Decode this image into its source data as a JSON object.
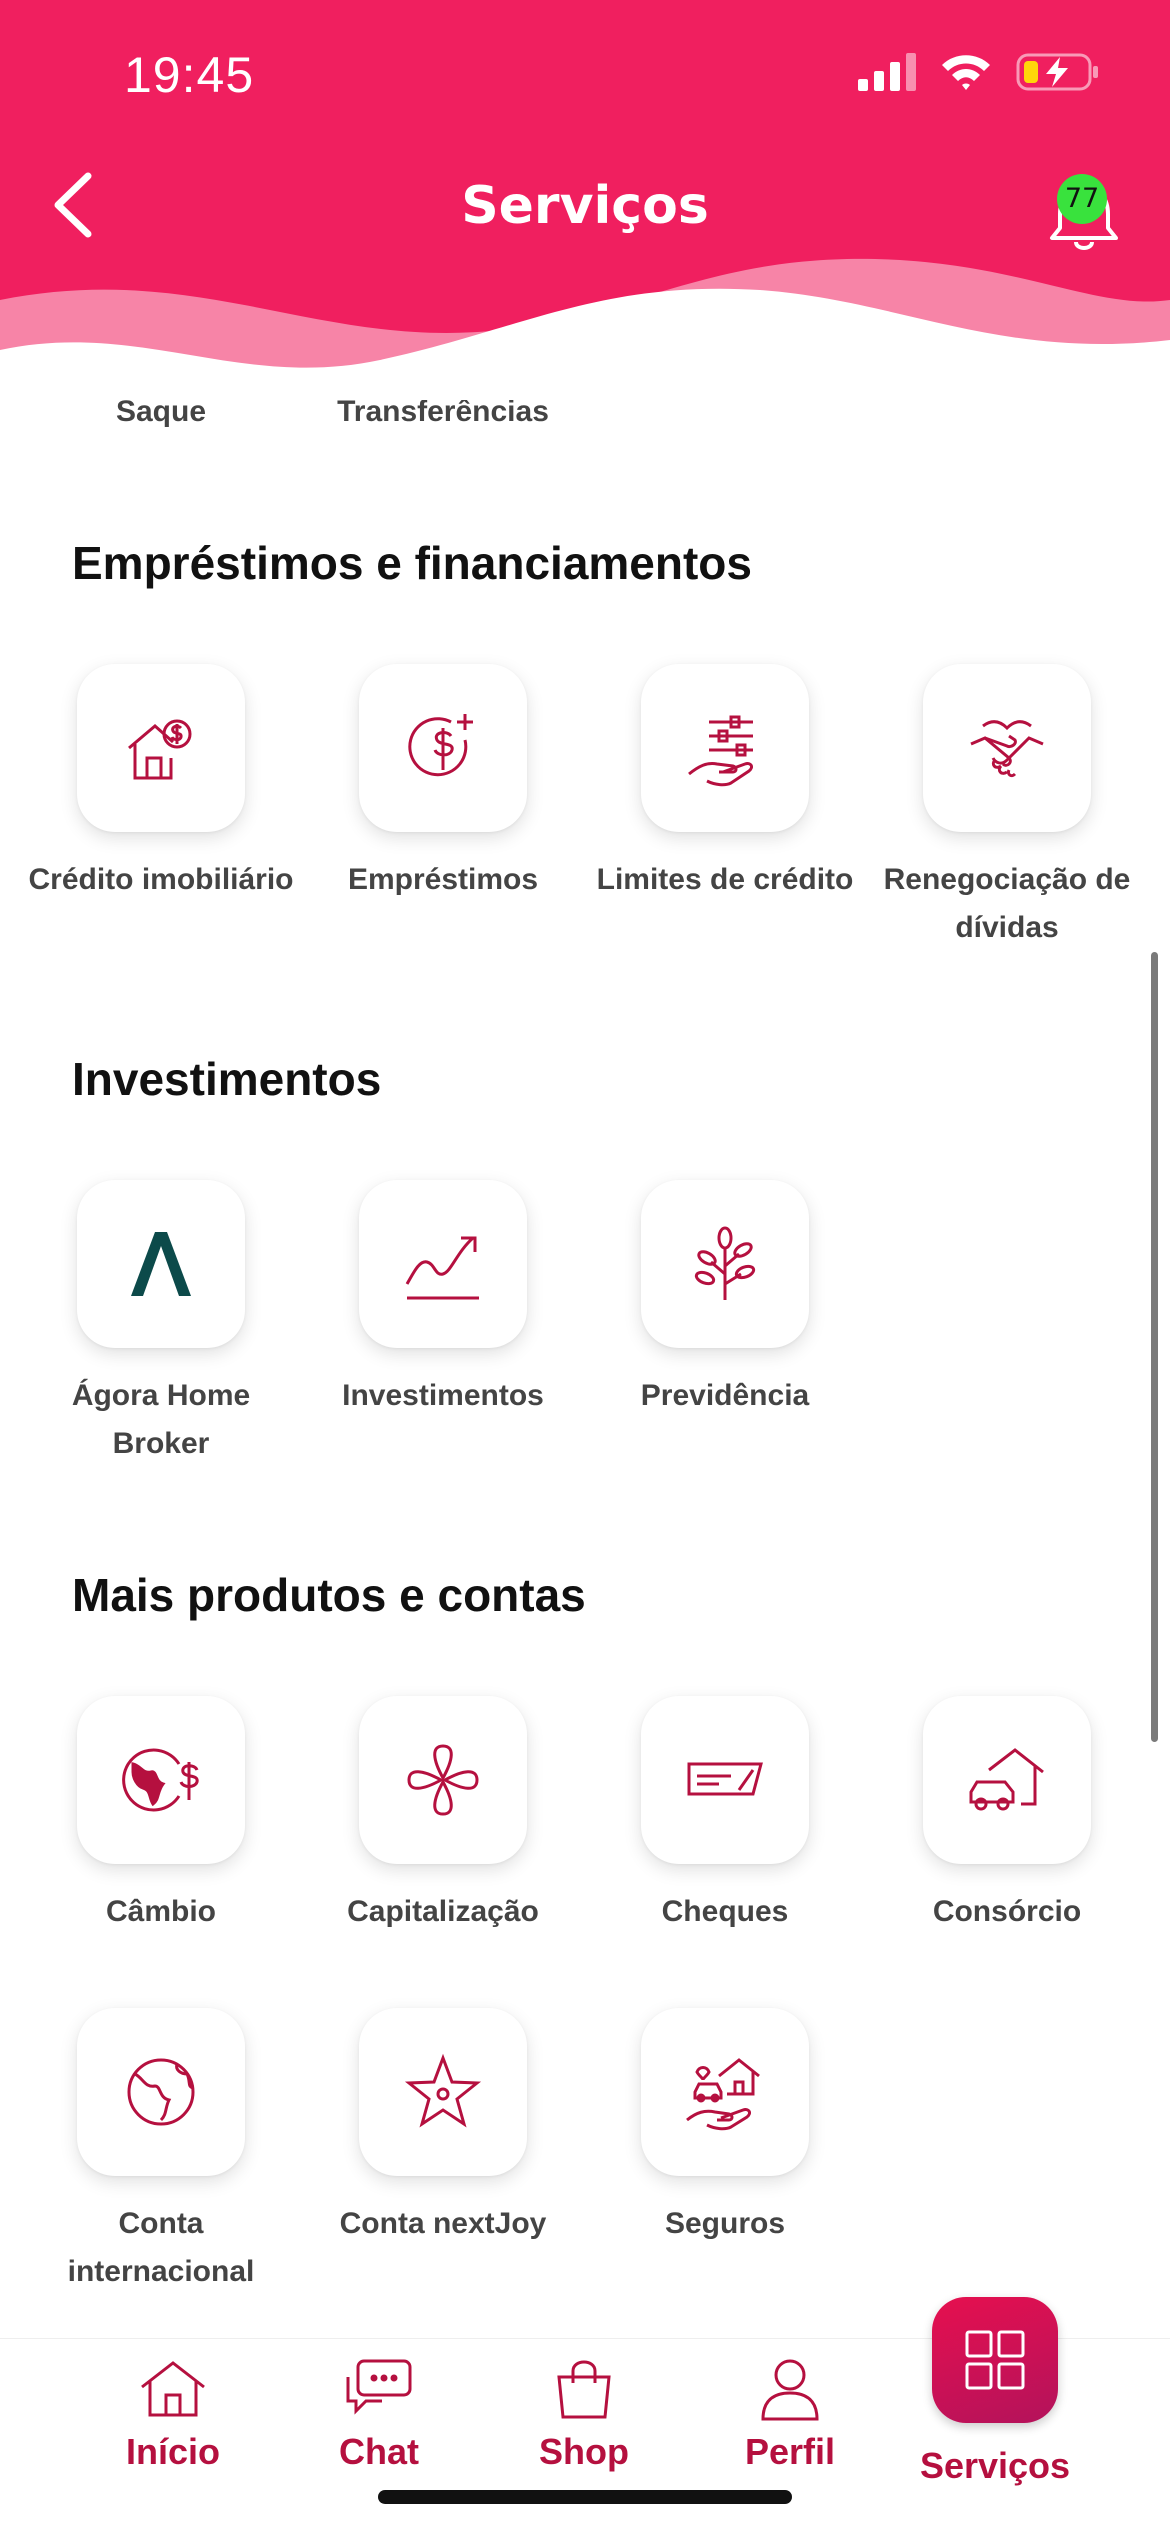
{
  "status_bar": {
    "time": "19:45"
  },
  "header": {
    "title": "Serviços",
    "notification_count": "77"
  },
  "peek_row": [
    {
      "label": "Saque",
      "icon": "cash-withdraw-icon"
    },
    {
      "label": "Transferências",
      "icon": "transfer-arrow-icon"
    }
  ],
  "sections": [
    {
      "title": "Empréstimos e financiamentos",
      "items": [
        {
          "label": "Crédito imobiliário",
          "icon": "house-dollar-icon"
        },
        {
          "label": "Empréstimos",
          "icon": "dollar-plus-icon"
        },
        {
          "label": "Limites de crédito",
          "icon": "hand-sliders-icon"
        },
        {
          "label": "Renegociação de dívidas",
          "icon": "handshake-icon"
        }
      ]
    },
    {
      "title": "Investimentos",
      "items": [
        {
          "label": "Ágora Home Broker",
          "icon": "agora-logo-icon"
        },
        {
          "label": "Investimentos",
          "icon": "trend-chart-icon"
        },
        {
          "label": "Previdência",
          "icon": "tree-icon"
        }
      ]
    },
    {
      "title": "Mais produtos e contas",
      "items": [
        {
          "label": "Câmbio",
          "icon": "globe-dollar-icon"
        },
        {
          "label": "Capitalização",
          "icon": "clover-icon"
        },
        {
          "label": "Cheques",
          "icon": "cheque-icon"
        },
        {
          "label": "Consórcio",
          "icon": "house-car-icon"
        },
        {
          "label": "Conta internacional",
          "icon": "globe-icon"
        },
        {
          "label": "Conta nextJoy",
          "icon": "star-icon"
        },
        {
          "label": "Seguros",
          "icon": "hand-house-car-icon"
        }
      ]
    }
  ],
  "tabbar": {
    "items": [
      {
        "label": "Início",
        "icon": "home-icon"
      },
      {
        "label": "Chat",
        "icon": "chat-icon"
      },
      {
        "label": "Shop",
        "icon": "shopping-bag-icon"
      },
      {
        "label": "Perfil",
        "icon": "person-icon"
      },
      {
        "label": "Serviços",
        "icon": "grid-icon"
      }
    ]
  },
  "colors": {
    "brand": "#f01f5f",
    "icon": "#b5103f",
    "badge": "#39e23d"
  }
}
